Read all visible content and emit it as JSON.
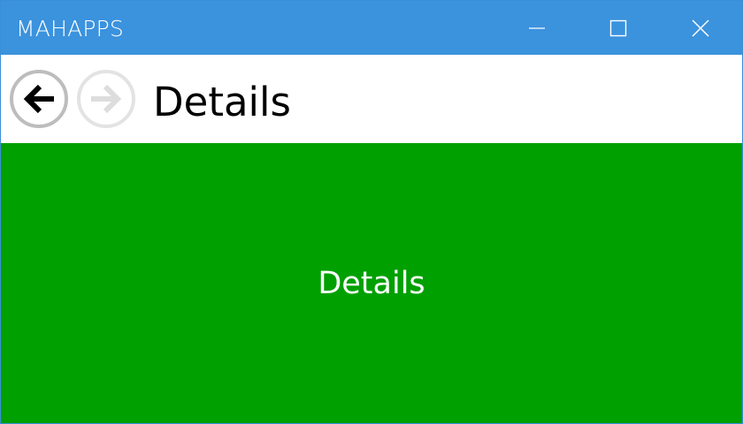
{
  "window": {
    "title": "MAHAPPS",
    "buttons": {
      "minimize_icon": "minimize-icon",
      "maximize_icon": "maximize-icon",
      "close_icon": "close-icon"
    }
  },
  "navigation": {
    "back_icon": "arrow-left-icon",
    "forward_icon": "arrow-right-icon",
    "back_enabled": true,
    "forward_enabled": false,
    "page_title": "Details"
  },
  "content": {
    "label": "Details"
  },
  "colors": {
    "titlebar": "#3b92dd",
    "content_background": "#00a000",
    "content_text": "#ffffff"
  }
}
